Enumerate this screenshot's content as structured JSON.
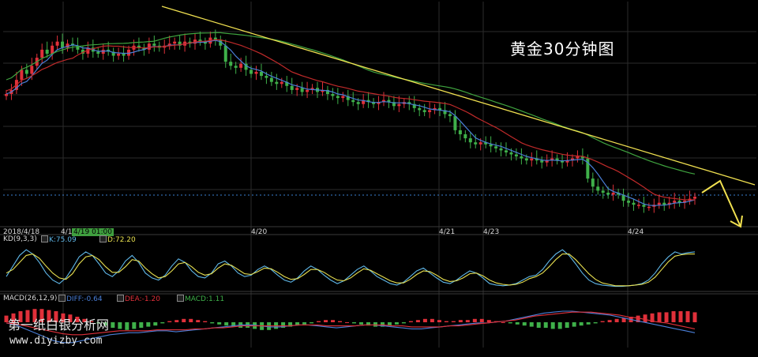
{
  "chart_data": {
    "type": "candlestick",
    "title": "黄金30分钟图",
    "date_labels": [
      "2018/4/18",
      "4/1",
      "4/20",
      "4/21",
      "4/23",
      "4/24"
    ],
    "highlight_label": "4/19 01:00",
    "watermark_text": "第一纸白银分析网",
    "watermark_url": "www.diyizby.com",
    "colors": {
      "up": "#e0303a",
      "down": "#3fb04a",
      "ma_blue": "#4a7fd8",
      "ma_red": "#c02a2a",
      "ma_green": "#3fa43f",
      "trend": "#f0e050",
      "grid": "#2b2b2b",
      "k_line": "#5fb7e8",
      "d_line": "#e8e050"
    },
    "price_close": [
      60,
      62,
      67,
      72,
      70,
      74,
      78,
      82,
      80,
      84,
      86,
      83,
      85,
      84,
      82,
      80,
      83,
      81,
      80,
      82,
      81,
      79,
      80,
      79,
      82,
      84,
      83,
      82,
      85,
      84,
      83,
      84,
      85,
      86,
      84,
      86,
      85,
      87,
      86,
      85,
      88,
      87,
      84,
      76,
      74,
      73,
      75,
      72,
      70,
      71,
      69,
      68,
      66,
      65,
      66,
      64,
      62,
      63,
      61,
      62,
      63,
      61,
      62,
      60,
      59,
      58,
      59,
      57,
      56,
      55,
      57,
      56,
      55,
      56,
      57,
      56,
      54,
      55,
      56,
      55,
      53,
      52,
      51,
      52,
      53,
      52,
      50,
      49,
      42,
      40,
      38,
      36,
      35,
      36,
      35,
      34,
      33,
      32,
      31,
      30,
      29,
      28,
      27,
      28,
      27,
      26,
      27,
      28,
      27,
      26,
      27,
      28,
      29,
      28,
      18,
      14,
      12,
      11,
      10,
      11,
      10,
      7,
      6,
      5,
      5,
      4,
      4,
      5,
      6,
      5,
      6,
      7,
      6,
      7,
      8,
      9
    ],
    "kd": {
      "label": "KD(9,3,3)",
      "k_label": "K:75.09",
      "d_label": "D:72.20",
      "k": [
        40,
        55,
        70,
        78,
        72,
        60,
        45,
        35,
        30,
        38,
        52,
        68,
        75,
        70,
        58,
        45,
        40,
        48,
        62,
        70,
        60,
        45,
        38,
        35,
        42,
        55,
        65,
        60,
        48,
        40,
        38,
        45,
        58,
        62,
        55,
        45,
        40,
        42,
        50,
        55,
        50,
        42,
        35,
        32,
        38,
        48,
        55,
        50,
        42,
        35,
        30,
        34,
        42,
        50,
        55,
        48,
        40,
        35,
        30,
        28,
        32,
        40,
        48,
        52,
        45,
        38,
        32,
        30,
        35,
        42,
        48,
        45,
        38,
        30,
        28,
        27,
        28,
        30,
        35,
        40,
        42,
        50,
        62,
        72,
        78,
        70,
        58,
        45,
        35,
        30,
        28,
        27,
        26,
        26,
        27,
        28,
        30,
        35,
        45,
        58,
        68,
        75,
        72,
        74,
        75
      ],
      "d": [
        45,
        50,
        60,
        70,
        72,
        66,
        55,
        45,
        38,
        36,
        44,
        58,
        68,
        70,
        64,
        54,
        46,
        46,
        54,
        64,
        62,
        52,
        44,
        38,
        40,
        48,
        58,
        60,
        54,
        46,
        42,
        44,
        52,
        58,
        56,
        50,
        44,
        43,
        47,
        52,
        51,
        46,
        40,
        36,
        37,
        43,
        50,
        50,
        46,
        40,
        35,
        34,
        38,
        45,
        51,
        49,
        44,
        39,
        34,
        31,
        31,
        36,
        43,
        48,
        47,
        42,
        36,
        33,
        34,
        38,
        44,
        45,
        41,
        35,
        31,
        29,
        28,
        29,
        32,
        37,
        40,
        45,
        54,
        64,
        72,
        72,
        64,
        54,
        44,
        36,
        31,
        29,
        27,
        27,
        27,
        28,
        29,
        32,
        39,
        50,
        61,
        69,
        71,
        72,
        72
      ]
    },
    "macd": {
      "label": "MACD(26,12,9)",
      "diff_label": "DIFF:-0.64",
      "dea_label": "DEA:-1.20",
      "macd_label": "MACD:1.11",
      "bars": [
        6,
        8,
        10,
        11,
        12,
        12,
        11,
        10,
        8,
        7,
        5,
        3,
        1,
        -1,
        -3,
        -5,
        -6,
        -7,
        -6,
        -5,
        -4,
        -3,
        -1,
        1,
        2,
        3,
        3,
        2,
        1,
        -1,
        -2,
        -3,
        -4,
        -5,
        -5,
        -6,
        -7,
        -7,
        -6,
        -5,
        -4,
        -3,
        -2,
        -1,
        1,
        2,
        2,
        1,
        0,
        -1,
        -2,
        -3,
        -4,
        -4,
        -3,
        -2,
        -1,
        1,
        2,
        3,
        3,
        2,
        1,
        1,
        2,
        2,
        3,
        3,
        2,
        1,
        0,
        -1,
        -2,
        -3,
        -4,
        -5,
        -5,
        -6,
        -6,
        -5,
        -4,
        -3,
        -2,
        -1,
        1,
        2,
        3,
        4,
        5,
        6,
        7,
        8,
        9,
        9,
        10,
        10,
        10,
        9
      ],
      "diff": [
        30,
        28,
        24,
        20,
        16,
        12,
        10,
        10,
        12,
        14,
        16,
        18,
        19,
        20,
        20,
        21,
        22,
        22,
        21,
        22,
        23,
        24,
        25,
        26,
        27,
        28,
        28,
        27,
        26,
        26,
        27,
        28,
        28,
        27,
        26,
        25,
        26,
        27,
        28,
        28,
        27,
        26,
        25,
        24,
        24,
        25,
        26,
        27,
        28,
        29,
        30,
        30,
        31,
        32,
        34,
        36,
        38,
        40,
        41,
        42,
        42,
        41,
        40,
        39,
        38,
        36,
        34,
        32,
        30,
        28,
        26,
        24,
        22,
        20
      ],
      "dea": [
        30,
        29,
        27,
        25,
        23,
        21,
        19,
        18,
        18,
        19,
        20,
        21,
        22,
        22,
        22,
        22,
        23,
        23,
        23,
        23,
        24,
        24,
        25,
        25,
        26,
        27,
        27,
        27,
        27,
        27,
        27,
        28,
        28,
        28,
        27,
        27,
        27,
        27,
        28,
        28,
        28,
        27,
        27,
        26,
        26,
        26,
        26,
        27,
        27,
        28,
        29,
        30,
        31,
        32,
        33,
        35,
        37,
        38,
        39,
        40,
        41,
        41,
        41,
        40,
        39,
        38,
        36,
        35,
        33,
        31,
        30,
        28,
        26,
        24
      ]
    }
  }
}
